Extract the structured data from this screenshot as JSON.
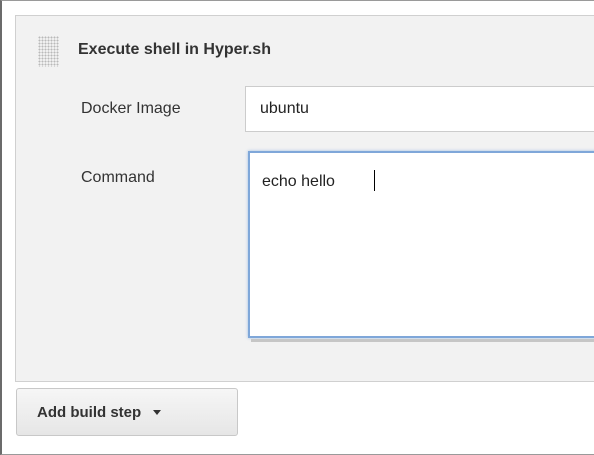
{
  "build_step": {
    "title": "Execute shell in Hyper.sh",
    "docker_image": {
      "label": "Docker Image",
      "value": "ubuntu"
    },
    "command": {
      "label": "Command",
      "value": "echo hello"
    }
  },
  "actions": {
    "add_build_step_label": "Add build step",
    "add_build_step_icon": "caret-down-icon"
  },
  "colors": {
    "panel_background": "#f2f2f2",
    "focus_border": "#7fa7d9"
  }
}
